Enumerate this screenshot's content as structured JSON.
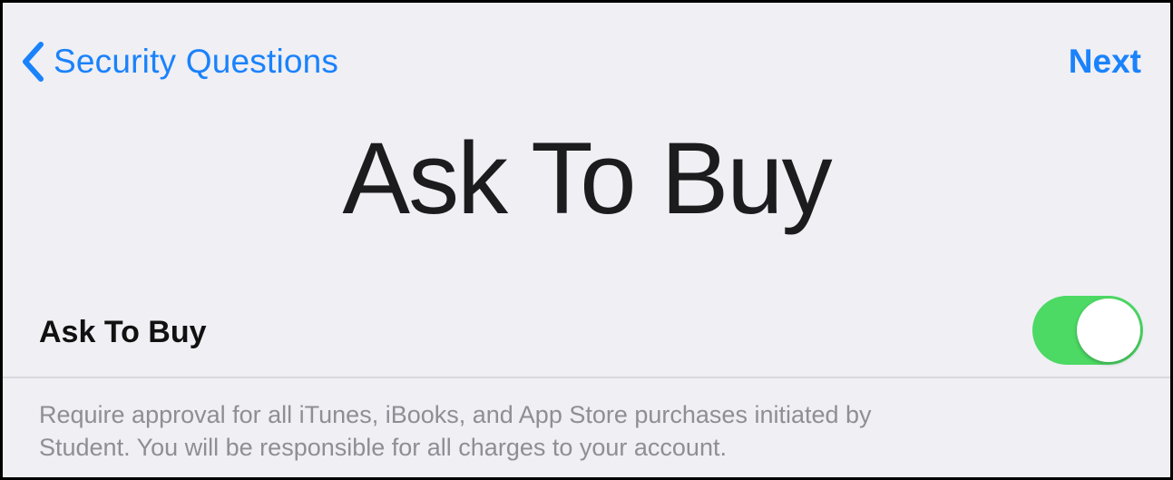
{
  "nav": {
    "back_label": "Security Questions",
    "next_label": "Next"
  },
  "page": {
    "title": "Ask To Buy"
  },
  "setting": {
    "label": "Ask To Buy",
    "toggle_on": true
  },
  "footer": {
    "line1": "Require approval for all iTunes, iBooks, and App Store purchases initiated by",
    "line2": "Student. You will be responsible for all charges to your account."
  },
  "colors": {
    "accent": "#1a82fb",
    "toggle_on": "#4cd964",
    "background": "#efeff4",
    "footer_text": "#8e8e93"
  },
  "icons": {
    "back": "chevron-left-icon"
  }
}
